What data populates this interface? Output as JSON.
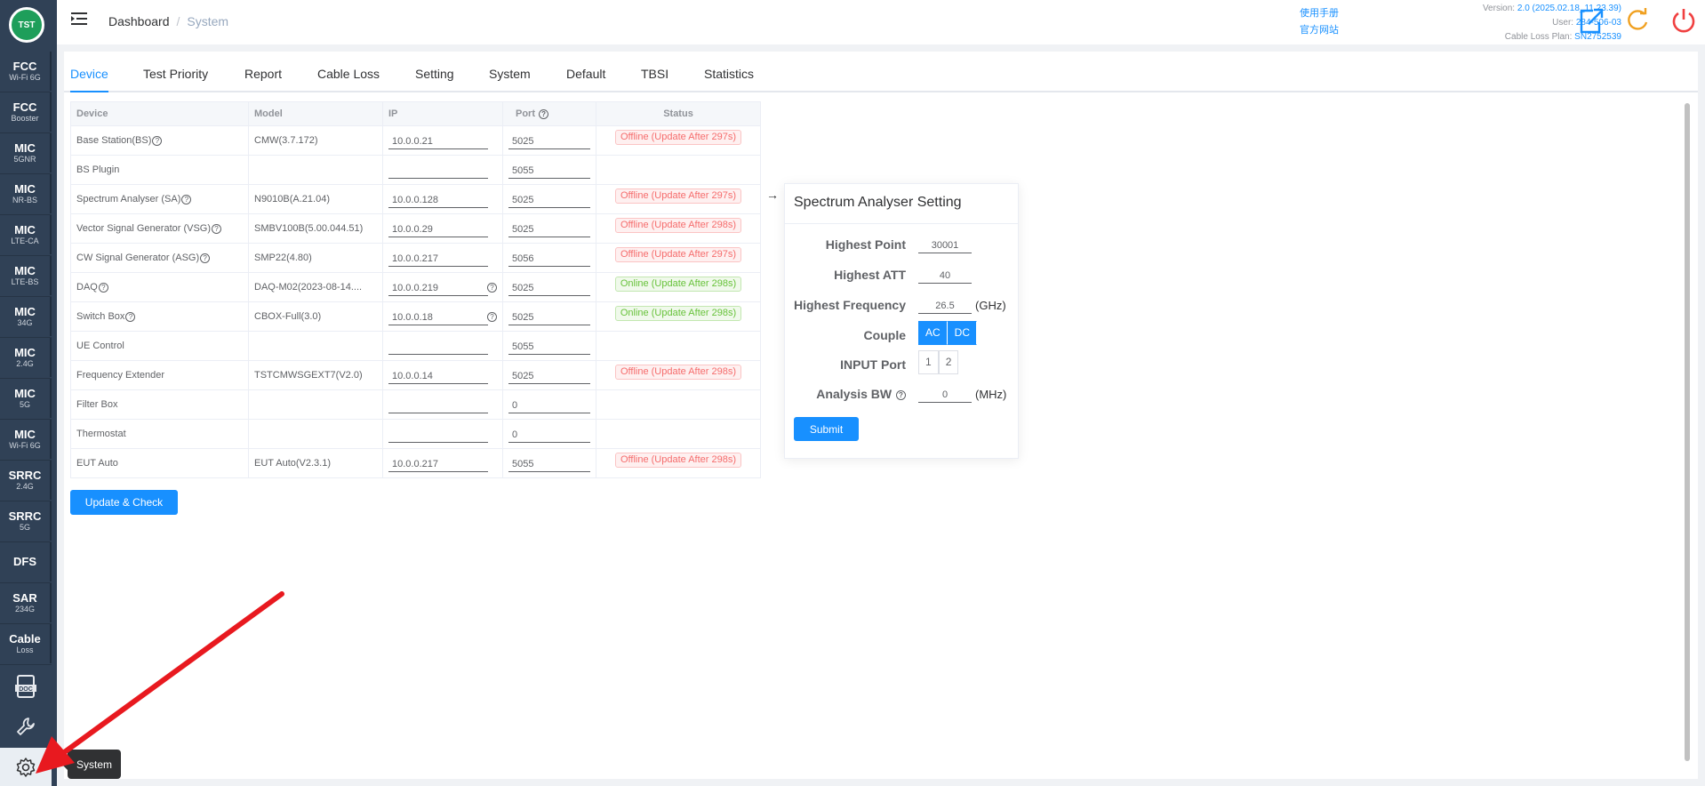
{
  "app": {
    "logo_text": "TST"
  },
  "sidebar": {
    "items": [
      {
        "title": "FCC",
        "sub": "Wi-Fi 6G"
      },
      {
        "title": "FCC",
        "sub": "Booster"
      },
      {
        "title": "MIC",
        "sub": "5GNR"
      },
      {
        "title": "MIC",
        "sub": "NR-BS"
      },
      {
        "title": "MIC",
        "sub": "LTE-CA"
      },
      {
        "title": "MIC",
        "sub": "LTE-BS"
      },
      {
        "title": "MIC",
        "sub": "34G"
      },
      {
        "title": "MIC",
        "sub": "2.4G"
      },
      {
        "title": "MIC",
        "sub": "5G"
      },
      {
        "title": "MIC",
        "sub": "Wi-Fi 6G"
      },
      {
        "title": "SRRC",
        "sub": "2.4G"
      },
      {
        "title": "SRRC",
        "sub": "5G"
      },
      {
        "title": "DFS",
        "sub": ""
      },
      {
        "title": "SAR",
        "sub": "234G"
      },
      {
        "title": "Cable",
        "sub": "Loss"
      }
    ],
    "doc_icon": "doc-icon",
    "tool_icon": "wrench-icon",
    "system_icon": "gear-icon",
    "tooltip": "System"
  },
  "header": {
    "breadcrumb_home": "Dashboard",
    "breadcrumb_sep": "/",
    "breadcrumb_current": "System",
    "link_manual": "使用手册",
    "link_site": "官方网站",
    "version_label": "Version:",
    "version_value": "2.0 (2025.02.18_11.23.39)",
    "user_label": "User:",
    "user_value": "284-506-03",
    "plan_label": "Cable Loss Plan:",
    "plan_value": "SN2752539"
  },
  "tabs": [
    "Device",
    "Test Priority",
    "Report",
    "Cable Loss",
    "Setting",
    "System",
    "Default",
    "TBSI",
    "Statistics"
  ],
  "table": {
    "headers": {
      "device": "Device",
      "model": "Model",
      "ip": "IP",
      "port": "Port",
      "status": "Status"
    },
    "rows": [
      {
        "device": "Base Station(BS)",
        "help": true,
        "model": "CMW(3.7.172)",
        "ip": "10.0.0.21",
        "ip_help": false,
        "port": "5025",
        "status": "Offline (Update After 297s)",
        "state": "off"
      },
      {
        "device": "BS Plugin",
        "help": false,
        "model": "",
        "ip": "",
        "ip_help": false,
        "port": "5055",
        "status": "",
        "state": ""
      },
      {
        "device": "Spectrum Analyser (SA)",
        "help": true,
        "model": "N9010B(A.21.04)",
        "ip": "10.0.0.128",
        "ip_help": false,
        "port": "5025",
        "status": "Offline (Update After 297s)",
        "state": "off"
      },
      {
        "device": "Vector Signal Generator (VSG)",
        "help": true,
        "model": "SMBV100B(5.00.044.51)",
        "ip": "10.0.0.29",
        "ip_help": false,
        "port": "5025",
        "status": "Offline (Update After 298s)",
        "state": "off"
      },
      {
        "device": "CW Signal Generator (ASG)",
        "help": true,
        "model": "SMP22(4.80)",
        "ip": "10.0.0.217",
        "ip_help": false,
        "port": "5056",
        "status": "Offline (Update After 297s)",
        "state": "off"
      },
      {
        "device": "DAQ",
        "help": true,
        "model": "DAQ-M02(2023-08-14....",
        "ip": "10.0.0.219",
        "ip_help": true,
        "port": "5025",
        "status": "Online (Update After 298s)",
        "state": "on"
      },
      {
        "device": "Switch Box",
        "help": true,
        "model": "CBOX-Full(3.0)",
        "ip": "10.0.0.18",
        "ip_help": true,
        "port": "5025",
        "status": "Online (Update After 298s)",
        "state": "on"
      },
      {
        "device": "UE Control",
        "help": false,
        "model": "",
        "ip": "",
        "ip_help": false,
        "port": "5055",
        "status": "",
        "state": ""
      },
      {
        "device": "Frequency Extender",
        "help": false,
        "model": "TSTCMWSGEXT7(V2.0)",
        "ip": "10.0.0.14",
        "ip_help": false,
        "port": "5025",
        "status": "Offline (Update After 298s)",
        "state": "off"
      },
      {
        "device": "Filter Box",
        "help": false,
        "model": "",
        "ip": "",
        "ip_help": false,
        "port": "0",
        "status": "",
        "state": ""
      },
      {
        "device": "Thermostat",
        "help": false,
        "model": "",
        "ip": "",
        "ip_help": false,
        "port": "0",
        "status": "",
        "state": ""
      },
      {
        "device": "EUT Auto",
        "help": false,
        "model": "EUT Auto(V2.3.1)",
        "ip": "10.0.0.217",
        "ip_help": false,
        "port": "5055",
        "status": "Offline (Update After 298s)",
        "state": "off"
      }
    ],
    "update_button": "Update & Check"
  },
  "panel": {
    "title": "Spectrum Analyser Setting",
    "highest_point_label": "Highest Point",
    "highest_point_value": "30001",
    "highest_att_label": "Highest ATT",
    "highest_att_value": "40",
    "highest_freq_label": "Highest Frequency",
    "highest_freq_value": "26.5",
    "highest_freq_unit": "(GHz)",
    "couple_label": "Couple",
    "couple_options": [
      "AC",
      "DC"
    ],
    "input_port_label": "INPUT Port",
    "input_port_options": [
      "1",
      "2"
    ],
    "analysis_bw_label": "Analysis BW",
    "analysis_bw_value": "0",
    "analysis_bw_unit": "(MHz)",
    "submit": "Submit"
  },
  "colors": {
    "accent": "#1890ff",
    "sidebar": "#304156",
    "offline": "#f56c6c",
    "online": "#67c23a",
    "annotation_arrow": "#e8191f"
  }
}
